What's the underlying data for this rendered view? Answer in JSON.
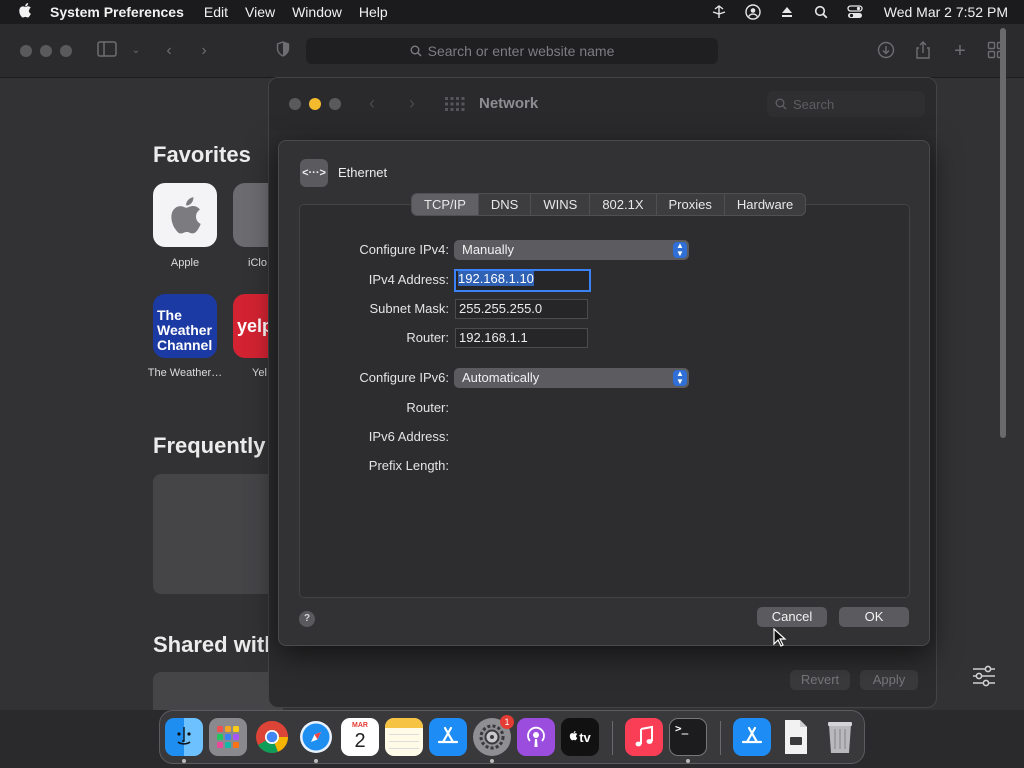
{
  "menubar": {
    "app_name": "System Preferences",
    "menus": [
      "Edit",
      "View",
      "Window",
      "Help"
    ],
    "clock": "Wed Mar 2  7:52 PM"
  },
  "safari": {
    "address_placeholder": "Search or enter website name",
    "favorites_title": "Favorites",
    "favorites": [
      {
        "label": "Apple"
      },
      {
        "label": "iClo"
      },
      {
        "label": "The Weather…"
      },
      {
        "label": "Yel"
      }
    ],
    "weather_tile_text": "The Weather Channel",
    "yelp_tile_text": "yelp",
    "frequently_title": "Frequently",
    "shared_title": "Shared with"
  },
  "prefs": {
    "title": "Network",
    "search_placeholder": "Search",
    "revert_label": "Revert",
    "apply_label": "Apply"
  },
  "sheet": {
    "interface_name": "Ethernet",
    "interface_icon": "<···>",
    "tabs": [
      "TCP/IP",
      "DNS",
      "WINS",
      "802.1X",
      "Proxies",
      "Hardware"
    ],
    "active_tab": "TCP/IP",
    "configure_ipv4_label": "Configure IPv4:",
    "configure_ipv4_value": "Manually",
    "ipv4_address_label": "IPv4 Address:",
    "ipv4_address_value": "192.168.1.10",
    "subnet_mask_label": "Subnet Mask:",
    "subnet_mask_value": "255.255.255.0",
    "router_label": "Router:",
    "router_value": "192.168.1.1",
    "configure_ipv6_label": "Configure IPv6:",
    "configure_ipv6_value": "Automatically",
    "router6_label": "Router:",
    "ipv6_address_label": "IPv6 Address:",
    "prefix_length_label": "Prefix Length:",
    "help_label": "?",
    "cancel_label": "Cancel",
    "ok_label": "OK"
  },
  "dock": {
    "calendar_month": "MAR",
    "calendar_day": "2",
    "tv_label": "tv",
    "settings_badge": "1"
  },
  "colors": {
    "accent": "#2f6fd6",
    "focus_ring": "#3b82f6",
    "traffic_yellow": "#f4bb2e",
    "traffic_gray": "#5a5a5c"
  }
}
